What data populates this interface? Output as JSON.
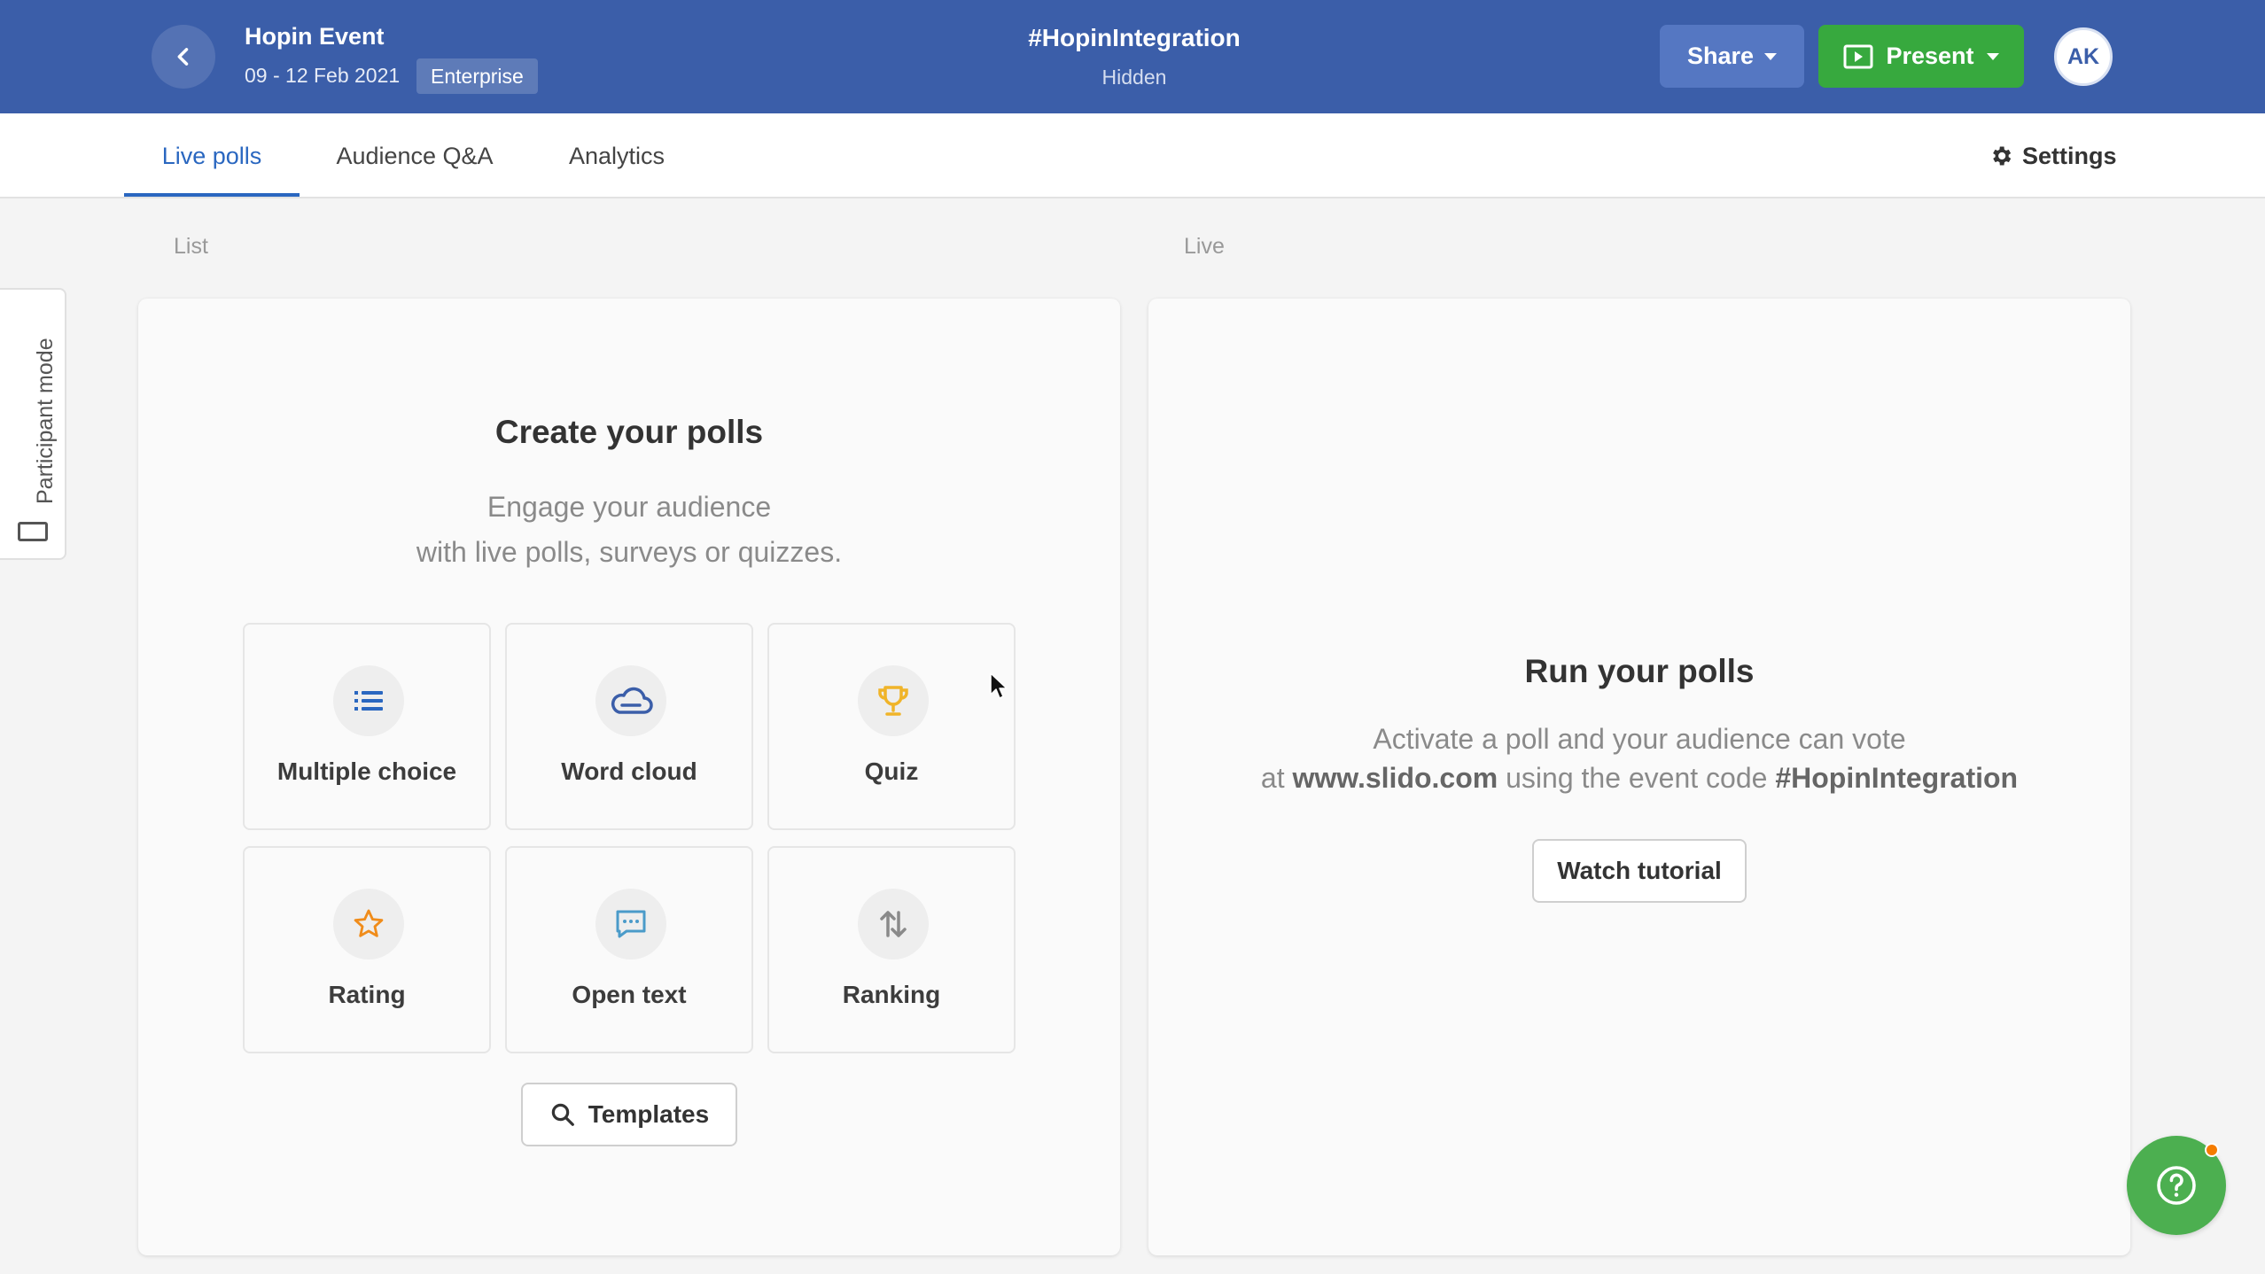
{
  "header": {
    "event_name": "Hopin Event",
    "event_dates": "09 - 12 Feb 2021",
    "plan_badge": "Enterprise",
    "event_code": "#HopinIntegration",
    "event_visibility": "Hidden",
    "share_label": "Share",
    "present_label": "Present",
    "avatar_initials": "AK"
  },
  "tabs": {
    "items": [
      {
        "label": "Live polls",
        "active": true
      },
      {
        "label": "Audience Q&A",
        "active": false
      },
      {
        "label": "Analytics",
        "active": false
      }
    ],
    "settings_label": "Settings"
  },
  "side_tab": {
    "label": "Participant mode"
  },
  "sections": {
    "list_label": "List",
    "live_label": "Live"
  },
  "create": {
    "title": "Create your polls",
    "subtitle_line1": "Engage your audience",
    "subtitle_line2": "with live polls, surveys or quizzes.",
    "poll_types": [
      {
        "label": "Multiple choice",
        "icon": "list-icon"
      },
      {
        "label": "Word cloud",
        "icon": "cloud-icon"
      },
      {
        "label": "Quiz",
        "icon": "trophy-icon"
      },
      {
        "label": "Rating",
        "icon": "star-icon"
      },
      {
        "label": "Open text",
        "icon": "chat-bubble-icon"
      },
      {
        "label": "Ranking",
        "icon": "sort-arrows-icon"
      }
    ],
    "templates_label": "Templates"
  },
  "run": {
    "title": "Run your polls",
    "line1": "Activate a poll and your audience can vote",
    "line2_prefix": "at",
    "url": "www.slido.com",
    "line2_middle": "using the event code",
    "code": "#HopinIntegration",
    "watch_label": "Watch tutorial"
  },
  "colors": {
    "header_bg": "#3b5ea9",
    "accent_blue": "#2a67c0",
    "present_green": "#37a93e",
    "help_green": "#4caf50",
    "notification_orange": "#f57c00"
  }
}
